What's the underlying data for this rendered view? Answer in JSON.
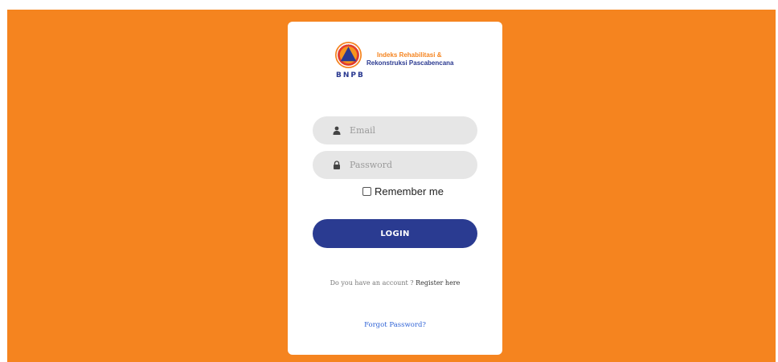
{
  "brand": {
    "acronym": "BNPB",
    "tagline_line1": "Indeks Rehabilitasi &",
    "tagline_line2": "Rekonstruksi Pascabencana",
    "emblem_icon": "bnpb-emblem-icon"
  },
  "form": {
    "email_placeholder": "Email",
    "email_value": "",
    "email_icon": "user-icon",
    "password_placeholder": "Password",
    "password_value": "",
    "password_icon": "lock-icon",
    "remember_label": "Remember me",
    "remember_checked": false,
    "login_label": "LOGIN"
  },
  "footer": {
    "account_prompt": "Do you have an account ? ",
    "register_label": "Register here",
    "forgot_label": "Forgot Password?"
  },
  "colors": {
    "background": "#f5841f",
    "primary": "#2a3b91",
    "field": "#e6e6e6",
    "link": "#2f63d6"
  }
}
